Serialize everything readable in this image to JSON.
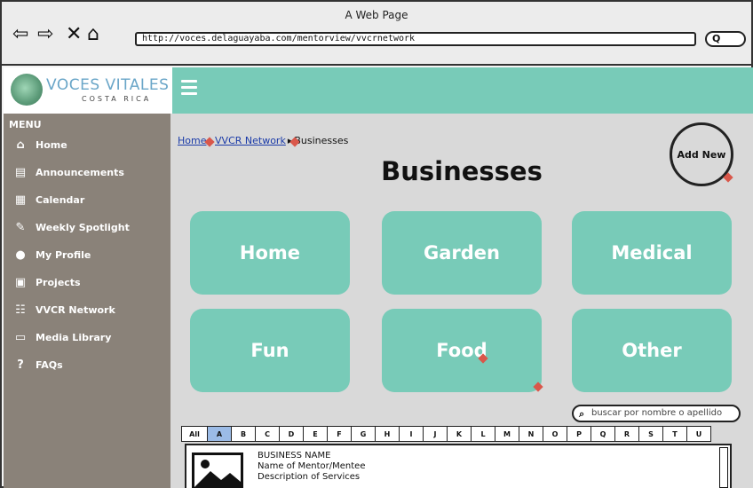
{
  "window": {
    "title": "A Web Page",
    "url": "http://voces.delaguayaba.com/mentorview/vvcrnetwork",
    "search_glyph": "Q"
  },
  "brand": {
    "name": "VOCES VITALES",
    "subtitle": "COSTA RICA",
    "accent_color": "#78cbb8",
    "sidebar_color": "#8a8279"
  },
  "sidebar": {
    "heading": "MENU",
    "items": [
      {
        "label": "Home",
        "icon": "home-icon"
      },
      {
        "label": "Announcements",
        "icon": "newspaper-icon"
      },
      {
        "label": "Calendar",
        "icon": "calendar-icon"
      },
      {
        "label": "Weekly Spotlight",
        "icon": "spotlight-icon"
      },
      {
        "label": "My Profile",
        "icon": "user-icon"
      },
      {
        "label": "Projects",
        "icon": "projects-icon"
      },
      {
        "label": "VVCR Network",
        "icon": "network-icon"
      },
      {
        "label": "Media Library",
        "icon": "monitor-icon"
      },
      {
        "label": "FAQs",
        "icon": "help-icon"
      }
    ]
  },
  "breadcrumb": {
    "home": "Home",
    "network": "VVCR Network",
    "current": "Businesses",
    "separator": "▸"
  },
  "page": {
    "title": "Businesses",
    "add_new": "Add New"
  },
  "categories": [
    "Home",
    "Garden",
    "Medical",
    "Fun",
    "Food",
    "Other"
  ],
  "directory": {
    "search_placeholder": "buscar por nombre o apellido",
    "letters": [
      "All",
      "A",
      "B",
      "C",
      "D",
      "E",
      "F",
      "G",
      "H",
      "I",
      "J",
      "K",
      "L",
      "M",
      "N",
      "O",
      "P",
      "Q",
      "R",
      "S",
      "T",
      "U"
    ],
    "active_letter": "A",
    "result": {
      "name": "BUSINESS NAME",
      "mentor": "Name of Mentor/Mentee",
      "description": "Description of Services"
    }
  }
}
